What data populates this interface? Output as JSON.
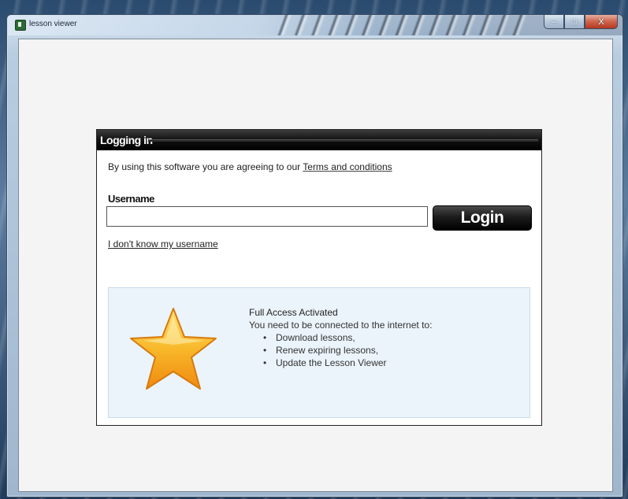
{
  "window": {
    "title": "lesson viewer",
    "buttons": {
      "minimize": "–",
      "maximize": "□",
      "close": "X"
    }
  },
  "login_panel": {
    "title": "Logging in",
    "terms_prefix": "By using this software you are agreeing to our ",
    "terms_link": "Terms and conditions",
    "username_label": "Username",
    "username_value": "",
    "login_button": "Login",
    "forgot_link": "I don't know my username"
  },
  "info": {
    "icon": "star-icon",
    "heading": "Full Access Activated",
    "description": "You need to be connected to the internet to:",
    "items": [
      "Download lessons,",
      "Renew expiring lessons,",
      "Update the Lesson Viewer"
    ]
  },
  "colors": {
    "header_bg": "#111111",
    "info_bg": "#ebf4fb",
    "star_fill": "#f7a21b"
  }
}
